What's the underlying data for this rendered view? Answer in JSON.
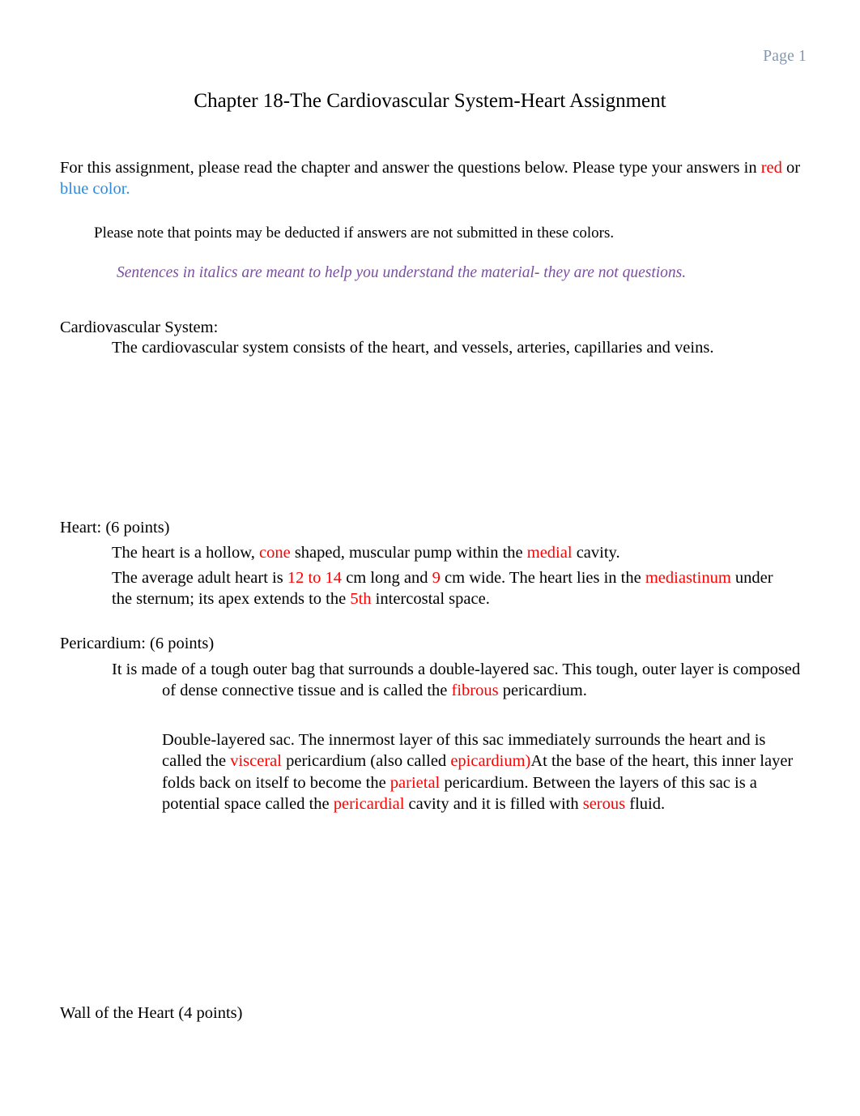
{
  "header": {
    "page_label": "Page 1"
  },
  "title": "Chapter 18-The Cardiovascular System-Heart Assignment",
  "colors": {
    "answer_red": "#ff0000",
    "answer_blue": "#2e8ae0",
    "italic_purple": "#7a4fa3",
    "header_gray_blue": "#8496b0",
    "body_text": "#000000",
    "page_background": "#ffffff"
  },
  "intro": {
    "line_a": "For this assignment, please read the chapter and answer the questions below. Please type your answers in ",
    "red_word": "red",
    "conjunction": " or ",
    "blue_word": "blue color."
  },
  "note": "Please note that points may be deducted if answers are not submitted in these colors.",
  "italic_note": "Sentences in italics are meant to help you understand the material- they are not questions.",
  "sections": {
    "cardiovascular_system": {
      "heading": "Cardiovascular System:",
      "body": "The cardiovascular system consists of the heart, and vessels, arteries, capillaries and veins."
    },
    "heart": {
      "heading": "Heart: (6 points)",
      "line1": {
        "part1": "The heart is a hollow, ",
        "answer1": "cone",
        "part2": " shaped, muscular pump within the ",
        "answer2": "medial",
        "part3": " cavity."
      },
      "line2": {
        "part1": "The average adult heart is ",
        "answer1": "12 to 14",
        "part2": " cm long and ",
        "answer2": "9",
        "part3": " cm wide. The heart lies in the ",
        "answer3": "mediastinum",
        "part4": " under the sternum; its apex extends to the ",
        "answer4": "5th",
        "part5": " intercostal space."
      }
    },
    "pericardium": {
      "heading": "Pericardium: (6 points)",
      "paragraph1": {
        "part1": "It is made of a tough outer bag that surrounds a double-layered sac. This tough, outer layer is composed",
        "part2": "of dense connective tissue and is called the ",
        "answer1": "fibrous",
        "part3": " pericardium."
      },
      "paragraph2": {
        "part1": "Double-layered sac. The innermost layer of this sac immediately surrounds the heart and is called the ",
        "answer1": "visceral",
        "part2": " pericardium (also called ",
        "answer2": "epicardium)",
        "part3": "At the base of the heart, this inner layer folds back on itself to become the ",
        "answer3": "parietal",
        "part4": " pericardium. Between the layers of this sac is a potential space called the ",
        "answer4": "pericardial",
        "part5": " cavity and it is filled with ",
        "answer5": "serous",
        "part6": " fluid."
      }
    },
    "wall_of_the_heart": {
      "heading": "Wall of the Heart (4 points)"
    }
  }
}
